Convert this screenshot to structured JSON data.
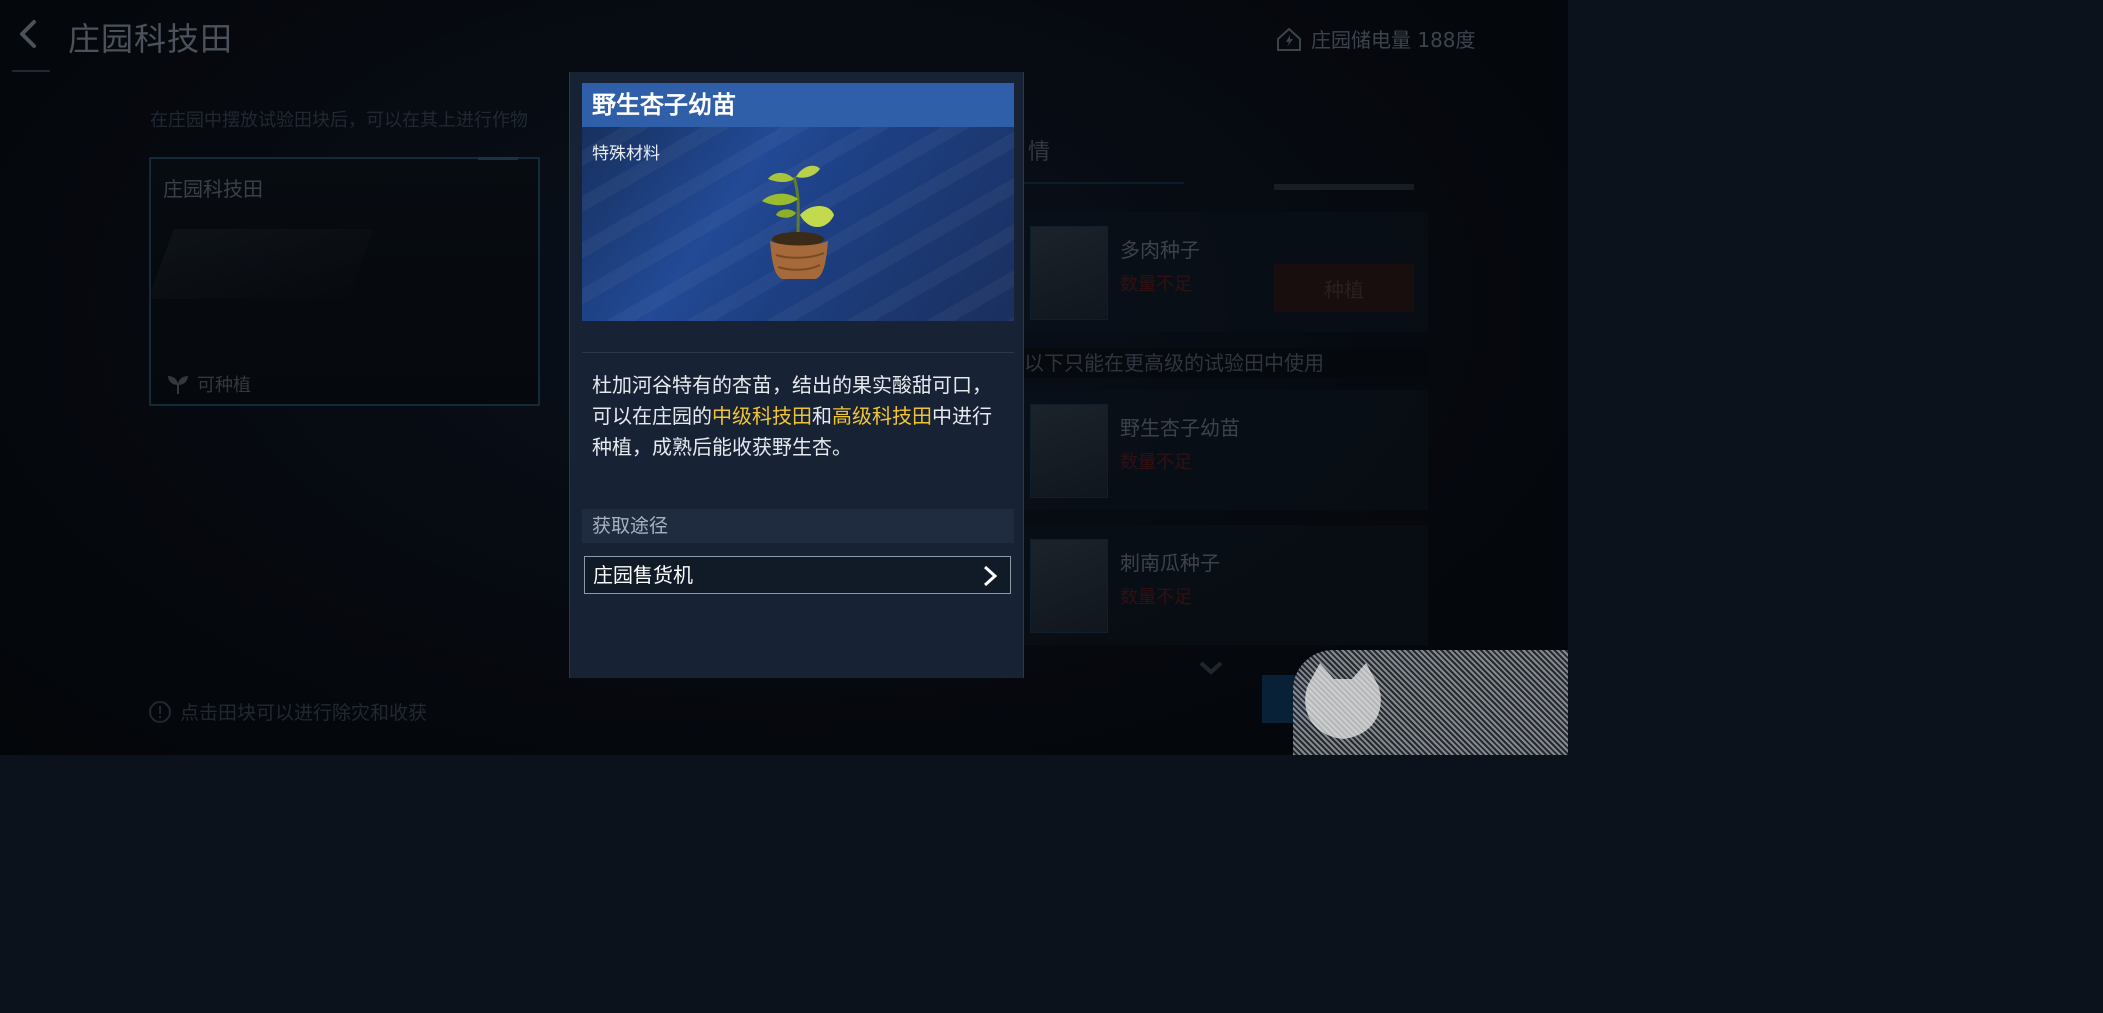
{
  "header": {
    "title": "庄园科技田",
    "storage_label": "庄园储电量 188度"
  },
  "hint_top": "在庄园中摆放试验田块后，可以在其上进行作物",
  "field": {
    "name": "庄园科技田",
    "status": "可种植"
  },
  "hint_bottom": "点击田块可以进行除灾和收获",
  "right_panel": {
    "title_fragment": "情",
    "seeds": [
      {
        "name": "多肉种子",
        "status": "数量不足",
        "button": "种植"
      },
      {
        "name": "野生杏子幼苗",
        "status": "数量不足"
      },
      {
        "name": "刺南瓜种子",
        "status": "数量不足"
      }
    ],
    "separator": "以下只能在更高级的试验田中使用"
  },
  "modal": {
    "title": "野生杏子幼苗",
    "category": "特殊材料",
    "desc_part1": "杜加河谷特有的杏苗，结出的果实酸甜可口，可以在庄园的",
    "desc_hl1": "中级科技田",
    "desc_part2": "和",
    "desc_hl2": "高级科技田",
    "desc_part3": "中进行种植，成熟后能收获野生杏。",
    "source_label": "获取途径",
    "source_item": "庄园售货机"
  },
  "colors": {
    "highlight": "#f2c530",
    "title_bar": "#2f5fa8",
    "warning": "#5a1e22"
  }
}
